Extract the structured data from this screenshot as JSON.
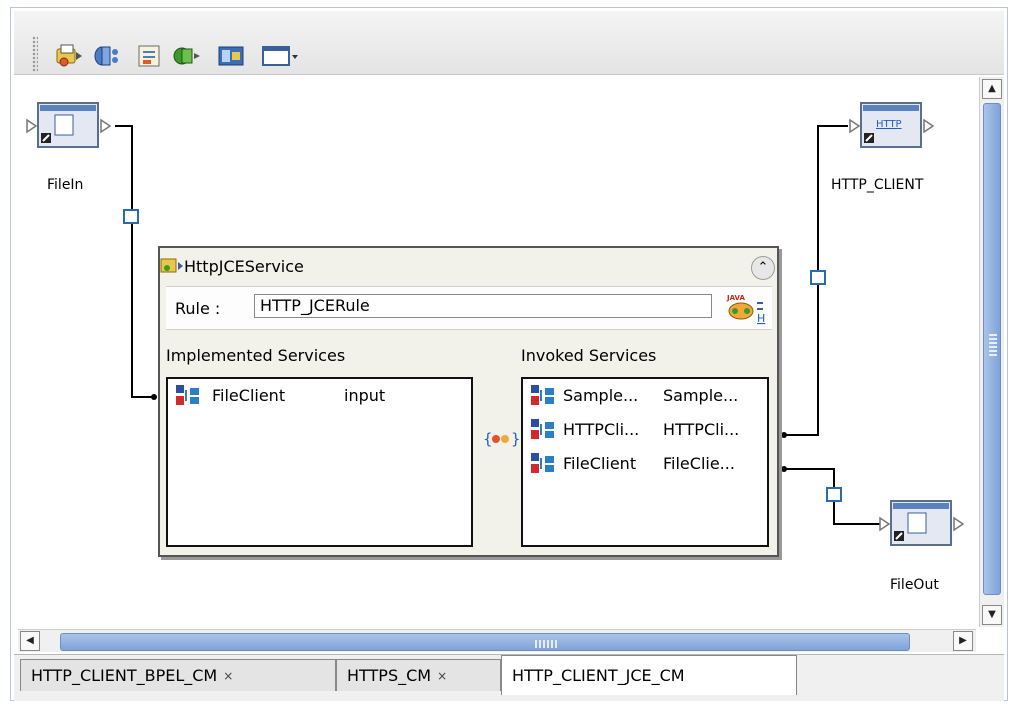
{
  "toolbar": {
    "buttons": [
      "collaboration-icon",
      "service-connector-icon",
      "rule-icon",
      "web-service-icon",
      "deployment-icon",
      "window-dropdown-icon"
    ]
  },
  "canvas": {
    "endpoints": {
      "filein": "FileIn",
      "http_client": "HTTP_CLIENT",
      "fileout": "FileOut"
    },
    "service": {
      "title": "HttpJCEService",
      "rule_label": "Rule :",
      "rule_value": "HTTP_JCERule",
      "implemented_label": "Implemented Services",
      "invoked_label": "Invoked Services",
      "implemented": [
        {
          "name": "FileClient",
          "op": "input"
        }
      ],
      "invoked": [
        {
          "name": "Sample...",
          "op": "Sample..."
        },
        {
          "name": "HTTPCli...",
          "op": "HTTPCli..."
        },
        {
          "name": "FileClient",
          "op": "FileClie..."
        }
      ]
    }
  },
  "tabs": [
    {
      "label": "HTTP_CLIENT_BPEL_CM",
      "close": "×"
    },
    {
      "label": "HTTPS_CM",
      "close": "×"
    },
    {
      "label": "HTTP_CLIENT_JCE_CM"
    }
  ],
  "colors": {
    "scroll_thumb": "#8eb0e0",
    "service_bg": "#f2f1ea",
    "link_blue": "#1f5fbf"
  }
}
